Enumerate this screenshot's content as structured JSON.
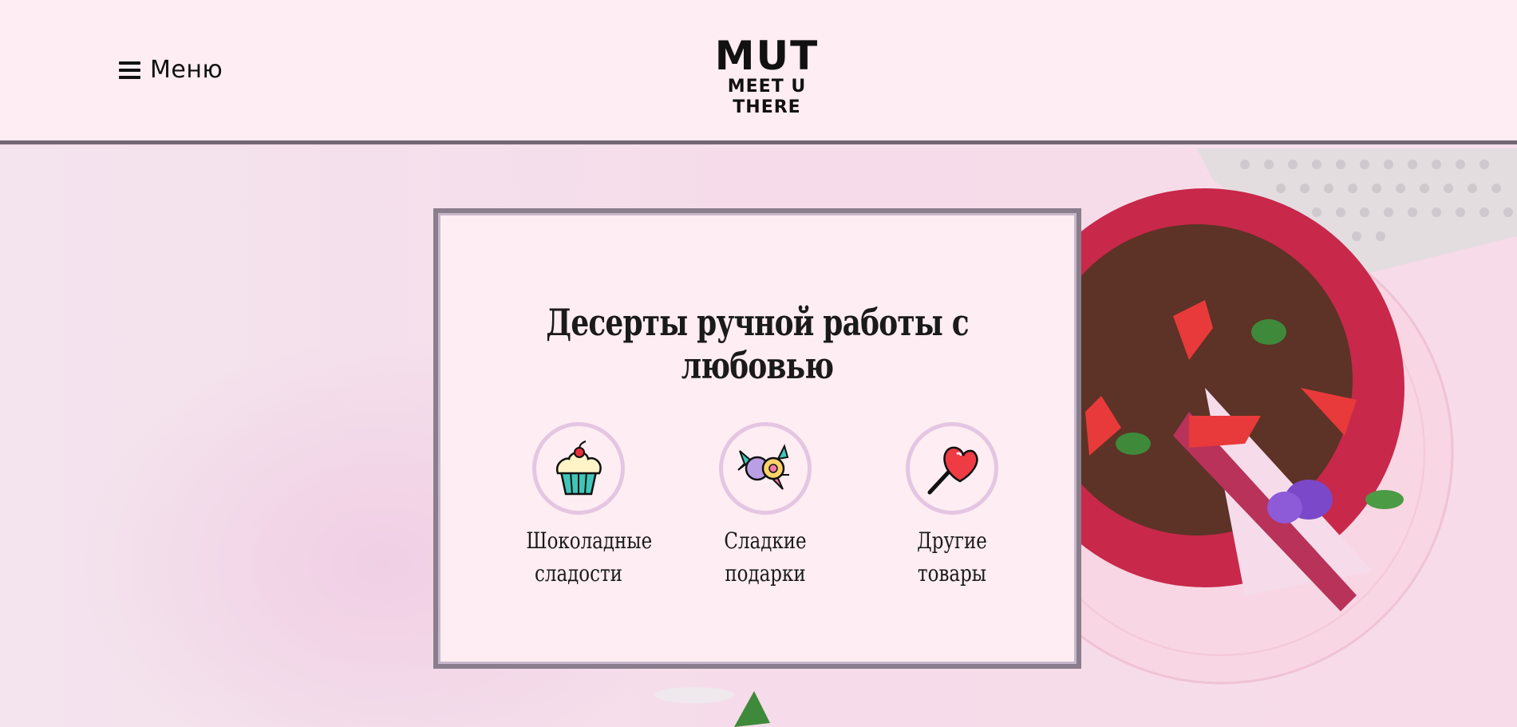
{
  "header": {
    "menu_label": "Меню",
    "logo_main": "MUT",
    "logo_sub": "MEET U THERE"
  },
  "card": {
    "title": "Десерты ручной работы с любовью",
    "categories": [
      {
        "line1": "Шоколадные",
        "line2": "сладости",
        "icon": "cupcake-icon"
      },
      {
        "line1": "Сладкие",
        "line2": "подарки",
        "icon": "candy-icon"
      },
      {
        "line1": "Другие",
        "line2": "товары",
        "icon": "heart-lollipop-icon"
      }
    ]
  },
  "colors": {
    "header_bg": "#feedf2",
    "header_border": "#736875",
    "card_border": "#8a7d8c",
    "icon_ring": "#e4c6e3"
  }
}
